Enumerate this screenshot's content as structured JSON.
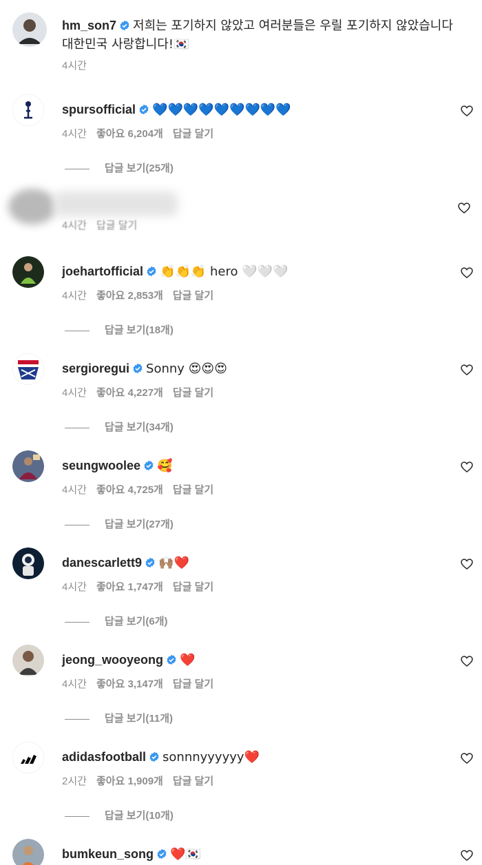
{
  "colors": {
    "verified": "#3897f0",
    "muted": "#8e8e8e",
    "text": "#262626"
  },
  "caption": {
    "username": "hm_son7",
    "text": "저희는 포기하지 않았고 여러분들은 우릴 포기하지 않았습니다 대한민국 사랑합니다!🇰🇷",
    "time": "4시간"
  },
  "blurred_comment": {
    "time": "4시간",
    "reply": "답글 달기"
  },
  "comments": [
    {
      "username": "spursofficial",
      "text": "💙💙💙💙💙💙💙💙💙",
      "time": "4시간",
      "likes": "좋아요 6,204개",
      "reply": "답글 달기",
      "view_replies": "답글 보기(25개)"
    },
    {
      "username": "joehartofficial",
      "text": "👏👏👏 hero 🤍🤍🤍",
      "time": "4시간",
      "likes": "좋아요 2,853개",
      "reply": "답글 달기",
      "view_replies": "답글 보기(18개)"
    },
    {
      "username": "sergioregui",
      "text": "Sonny 😍😍😍",
      "time": "4시간",
      "likes": "좋아요 4,227개",
      "reply": "답글 달기",
      "view_replies": "답글 보기(34개)"
    },
    {
      "username": "seungwoolee",
      "text": "🥰",
      "time": "4시간",
      "likes": "좋아요 4,725개",
      "reply": "답글 달기",
      "view_replies": "답글 보기(27개)"
    },
    {
      "username": "danescarlett9",
      "text": "🙌🏽❤️",
      "time": "4시간",
      "likes": "좋아요 1,747개",
      "reply": "답글 달기",
      "view_replies": "답글 보기(6개)"
    },
    {
      "username": "jeong_wooyeong",
      "text": "❤️",
      "time": "4시간",
      "likes": "좋아요 3,147개",
      "reply": "답글 달기",
      "view_replies": "답글 보기(11개)"
    },
    {
      "username": "adidasfootball",
      "text": "sonnnyyyyyy❤️",
      "time": "2시간",
      "likes": "좋아요 1,909개",
      "reply": "답글 달기",
      "view_replies": "답글 보기(10개)"
    },
    {
      "username": "bumkeun_song",
      "text": "❤️🇰🇷"
    }
  ]
}
